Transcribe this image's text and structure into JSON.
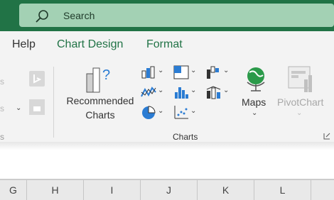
{
  "search": {
    "placeholder": "Search"
  },
  "tabs": [
    "Help",
    "Chart Design",
    "Format"
  ],
  "ribbon": {
    "recommended_charts": {
      "line1": "Recommended",
      "line2": "Charts"
    },
    "maps": "Maps",
    "pivotchart": "PivotChart",
    "group_label": "Charts",
    "left_ghost_fragment": "s",
    "left_ghost_fragment2": "s"
  },
  "columns": [
    "G",
    "H",
    "I",
    "J",
    "K",
    "L",
    ""
  ],
  "colors": {
    "title_bar": "#217346",
    "accent_tab": "#217346",
    "search_box": "#a3d1b4"
  }
}
